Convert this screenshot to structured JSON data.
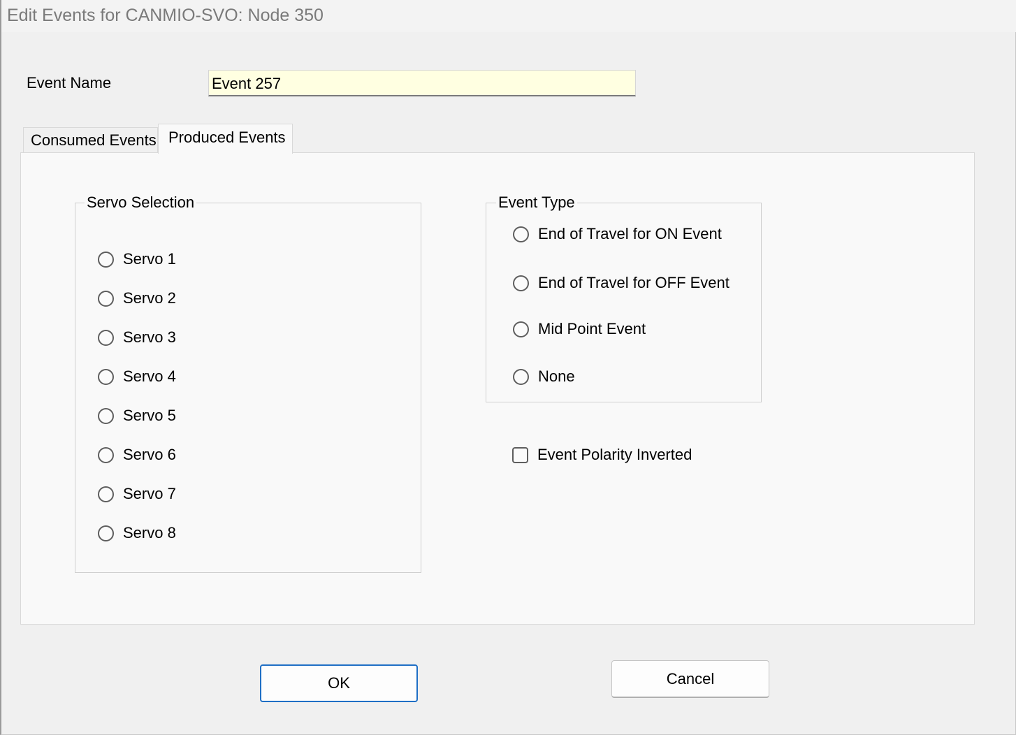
{
  "window": {
    "title": "Edit Events for CANMIO-SVO: Node 350"
  },
  "event_name": {
    "label": "Event Name",
    "value": "Event 257"
  },
  "tabs": [
    {
      "label": "Consumed Events",
      "active": false
    },
    {
      "label": "Produced Events",
      "active": true
    }
  ],
  "servo_selection": {
    "title": "Servo Selection",
    "options": [
      "Servo 1",
      "Servo 2",
      "Servo 3",
      "Servo 4",
      "Servo 5",
      "Servo 6",
      "Servo 7",
      "Servo 8"
    ],
    "selected": null
  },
  "event_type": {
    "title": "Event Type",
    "options": [
      "End of Travel for ON Event",
      "End of Travel for OFF Event",
      "Mid Point Event",
      "None"
    ],
    "selected": null
  },
  "polarity": {
    "label": "Event Polarity Inverted",
    "checked": false
  },
  "buttons": {
    "ok": "OK",
    "cancel": "Cancel"
  },
  "colors": {
    "dialog_bg": "#f0f0f0",
    "panel_bg": "#f9f9f9",
    "input_bg": "#ffffe1",
    "focus_border": "#1f6fc5",
    "title_text": "#7a7a7a"
  }
}
